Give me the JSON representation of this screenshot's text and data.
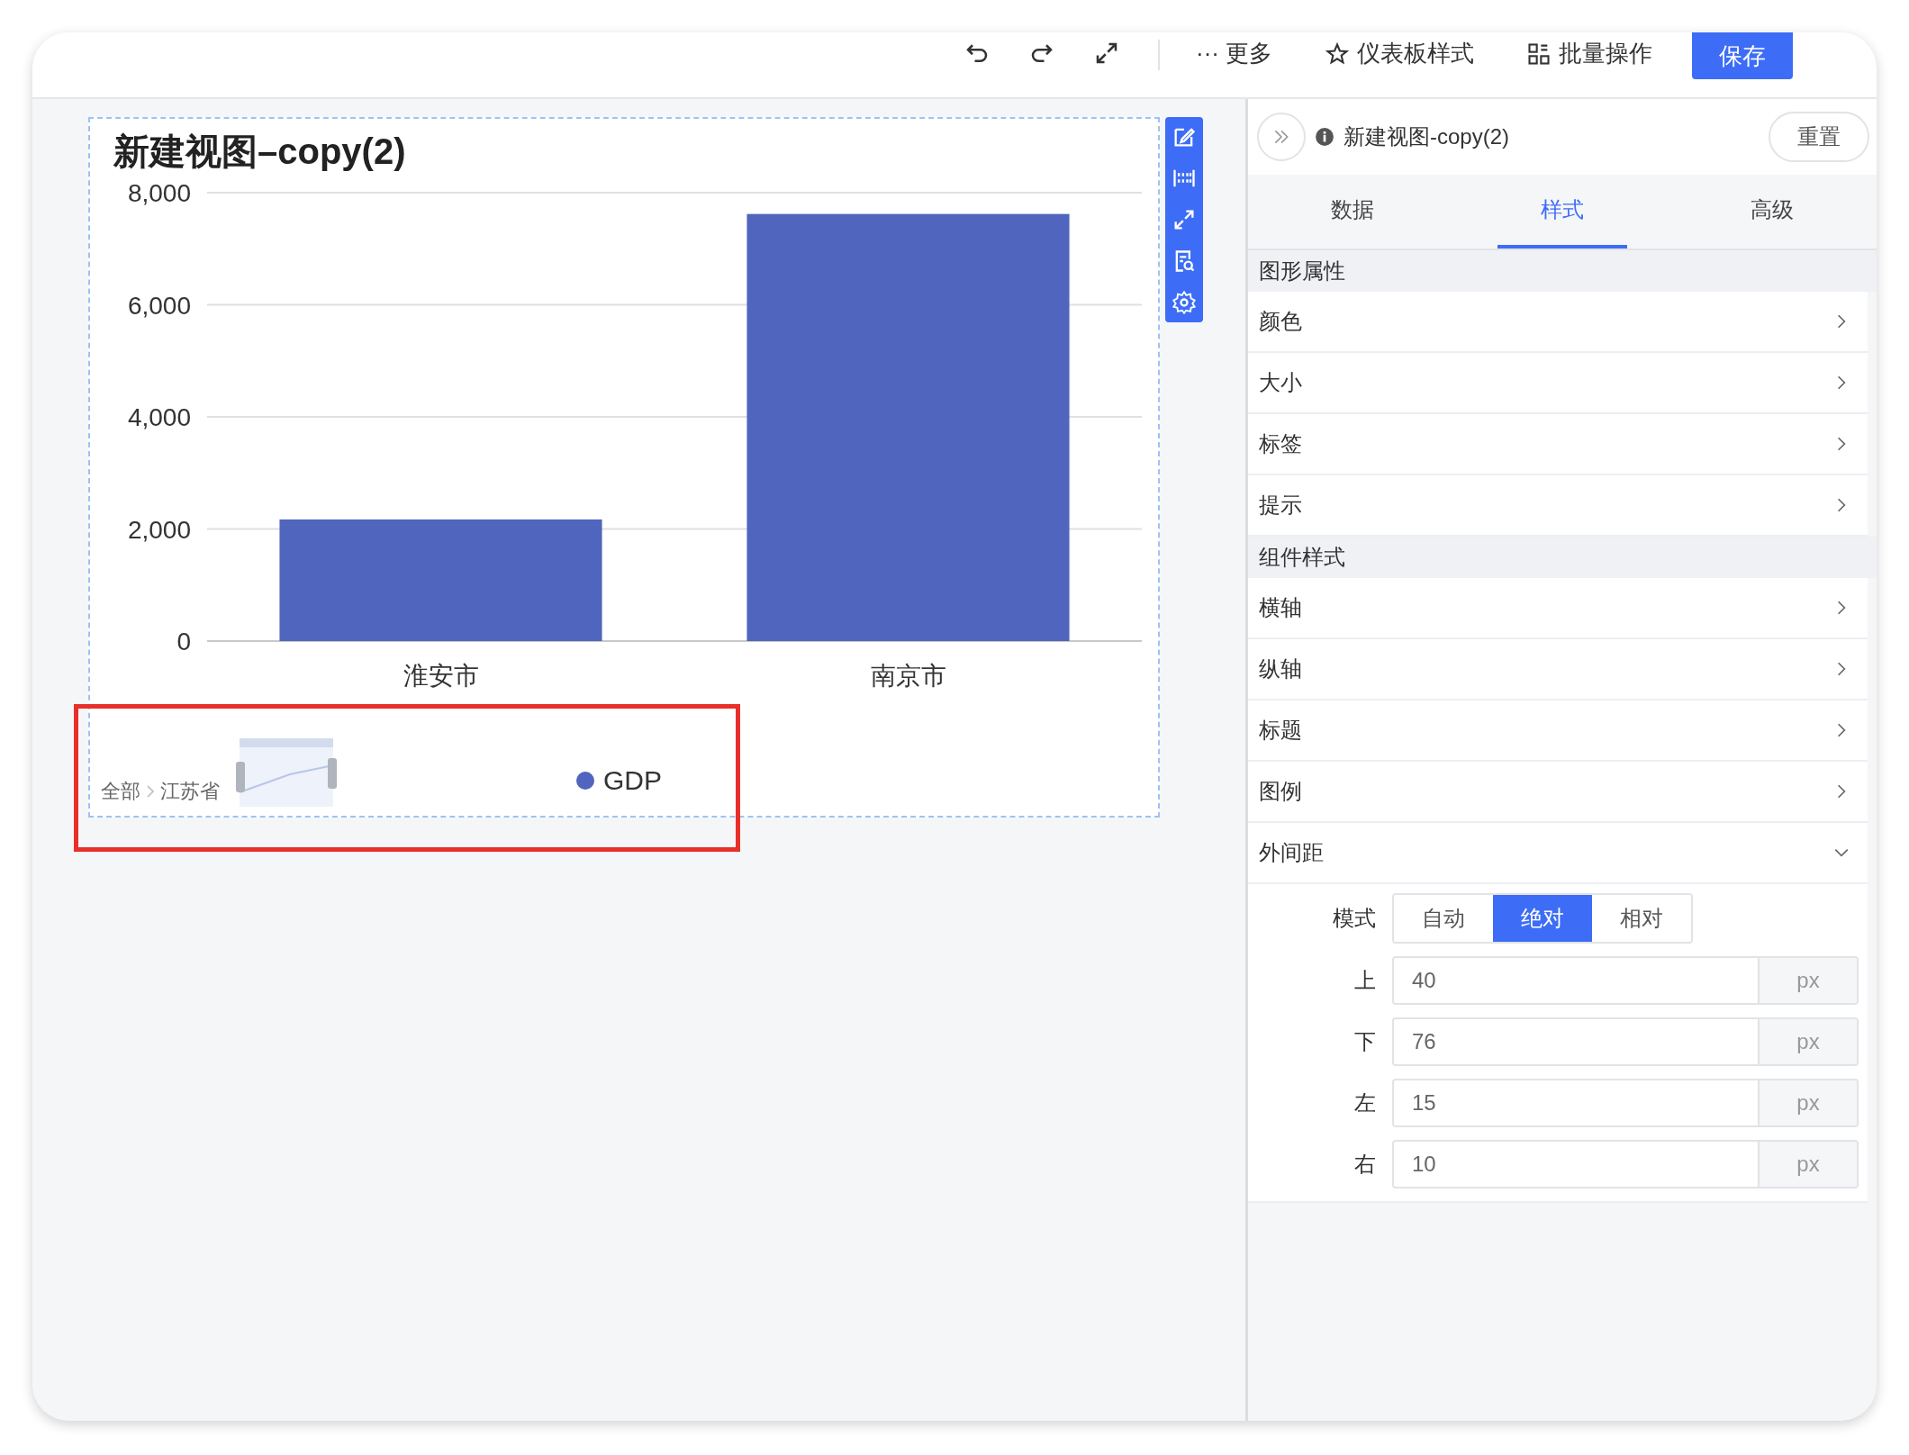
{
  "toolbar": {
    "more": {
      "glyph": "···",
      "label": "更多"
    },
    "dashboard_style": {
      "label": "仪表板样式"
    },
    "batch": {
      "label": "批量操作"
    },
    "save_button": "保存"
  },
  "chart": {
    "title": "新建视图–copy(2)",
    "chart_data": {
      "type": "bar",
      "categories": [
        "淮安市",
        "南京市"
      ],
      "series": [
        {
          "name": "GDP",
          "color": "#5065bd",
          "values": [
            2170,
            7620
          ]
        }
      ],
      "ylim": [
        0,
        8000
      ],
      "grid": true,
      "yticks": [
        {
          "value": 0,
          "label": "0"
        },
        {
          "value": 2000,
          "label": "2,000"
        },
        {
          "value": 4000,
          "label": "4,000"
        },
        {
          "value": 6000,
          "label": "6,000"
        },
        {
          "value": 8000,
          "label": "8,000"
        }
      ]
    },
    "breadcrumb": [
      "全部",
      "江苏省"
    ]
  },
  "panel": {
    "title": "新建视图-copy(2)",
    "reset_button": "重置",
    "tabs": [
      {
        "label": "数据",
        "selected": false
      },
      {
        "label": "样式",
        "selected": true
      },
      {
        "label": "高级",
        "selected": false
      }
    ],
    "sections": [
      {
        "title": "图形属性",
        "items": [
          {
            "label": "颜色",
            "expanded": false
          },
          {
            "label": "大小",
            "expanded": false
          },
          {
            "label": "标签",
            "expanded": false
          },
          {
            "label": "提示",
            "expanded": false
          }
        ]
      },
      {
        "title": "组件样式",
        "items": [
          {
            "label": "横轴",
            "expanded": false
          },
          {
            "label": "纵轴",
            "expanded": false
          },
          {
            "label": "标题",
            "expanded": false
          },
          {
            "label": "图例",
            "expanded": false
          },
          {
            "label": "外间距",
            "expanded": true,
            "mode": {
              "label": "模式",
              "options": [
                {
                  "label": "自动",
                  "selected": false
                },
                {
                  "label": "绝对",
                  "selected": true
                },
                {
                  "label": "相对",
                  "selected": false
                }
              ]
            },
            "fields": [
              {
                "label": "上",
                "value": "40",
                "unit": "px"
              },
              {
                "label": "下",
                "value": "76",
                "unit": "px"
              },
              {
                "label": "左",
                "value": "15",
                "unit": "px"
              },
              {
                "label": "右",
                "value": "10",
                "unit": "px"
              }
            ]
          }
        ]
      }
    ]
  }
}
